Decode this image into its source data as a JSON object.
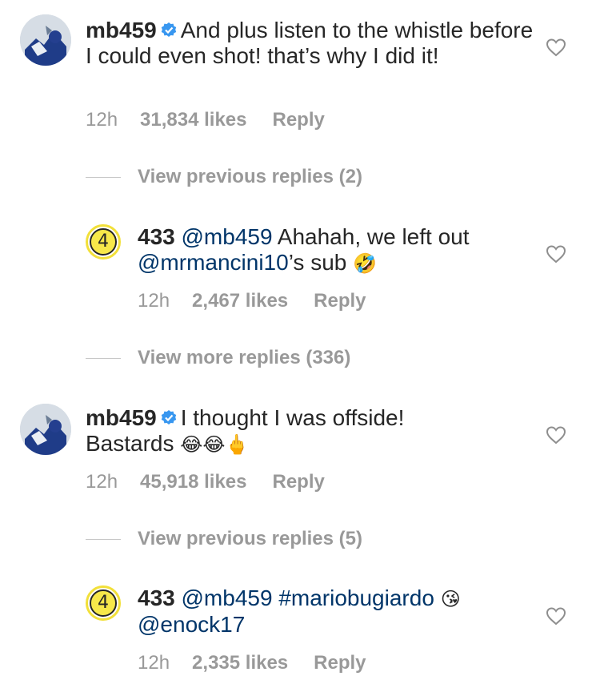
{
  "comments": [
    {
      "username": "mb459",
      "text": "And plus listen to the whistle before I could even shot!  that’s why I did it!",
      "time": "12h",
      "likes": "31,834 likes",
      "reply": "Reply"
    },
    {
      "username": "433",
      "mention": "@mb459",
      "text": "Ahahah, we left out",
      "mention2": "@mrmancini10",
      "text2": "’s sub",
      "emoji": "🤣",
      "time": "12h",
      "likes": "2,467 likes",
      "reply": "Reply"
    },
    {
      "username": "mb459",
      "text": "I thought I was offside!",
      "text2": "Bastards",
      "emoji": "😂😂🖕",
      "time": "12h",
      "likes": "45,918 likes",
      "reply": "Reply"
    },
    {
      "username": "433",
      "mention": "@mb459",
      "hashtag": "#mariobugiardo",
      "emoji": "😘",
      "mention2": "@enock17",
      "time": "12h",
      "likes": "2,335 likes",
      "reply": "Reply"
    }
  ],
  "view_links": [
    "View previous replies (2)",
    "View more replies (336)",
    "View previous replies (5)"
  ],
  "avatar_433_label": "4",
  "colors": {
    "text": "#262626",
    "meta": "#999999",
    "mention": "#003569",
    "verified": "#3897f0",
    "badge_yellow": "#f7e84a"
  }
}
